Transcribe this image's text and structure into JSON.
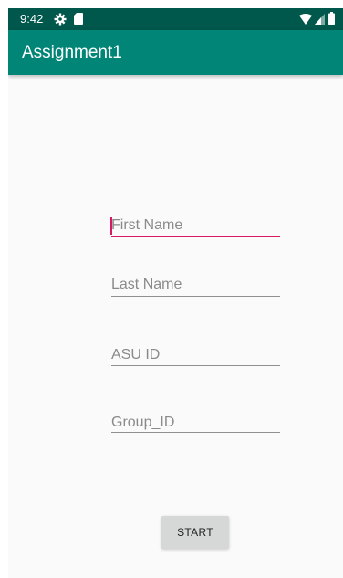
{
  "status_bar": {
    "time": "9:42",
    "icons": [
      "gear-icon",
      "sd-card-icon",
      "wifi-icon",
      "cell-signal-icon",
      "battery-icon"
    ],
    "color": "#00574b"
  },
  "app_bar": {
    "title": "Assignment1",
    "color": "#008577"
  },
  "form": {
    "first_name": {
      "placeholder": "First Name",
      "value": "",
      "focused": true
    },
    "last_name": {
      "placeholder": "Last Name",
      "value": ""
    },
    "asu_id": {
      "placeholder": "ASU ID",
      "value": ""
    },
    "group_id": {
      "placeholder": "Group_ID",
      "value": ""
    }
  },
  "start_button": {
    "label": "START"
  },
  "colors": {
    "accent": "#d81b60",
    "primary": "#008577",
    "primary_dark": "#00574b",
    "background": "#fafafa"
  }
}
